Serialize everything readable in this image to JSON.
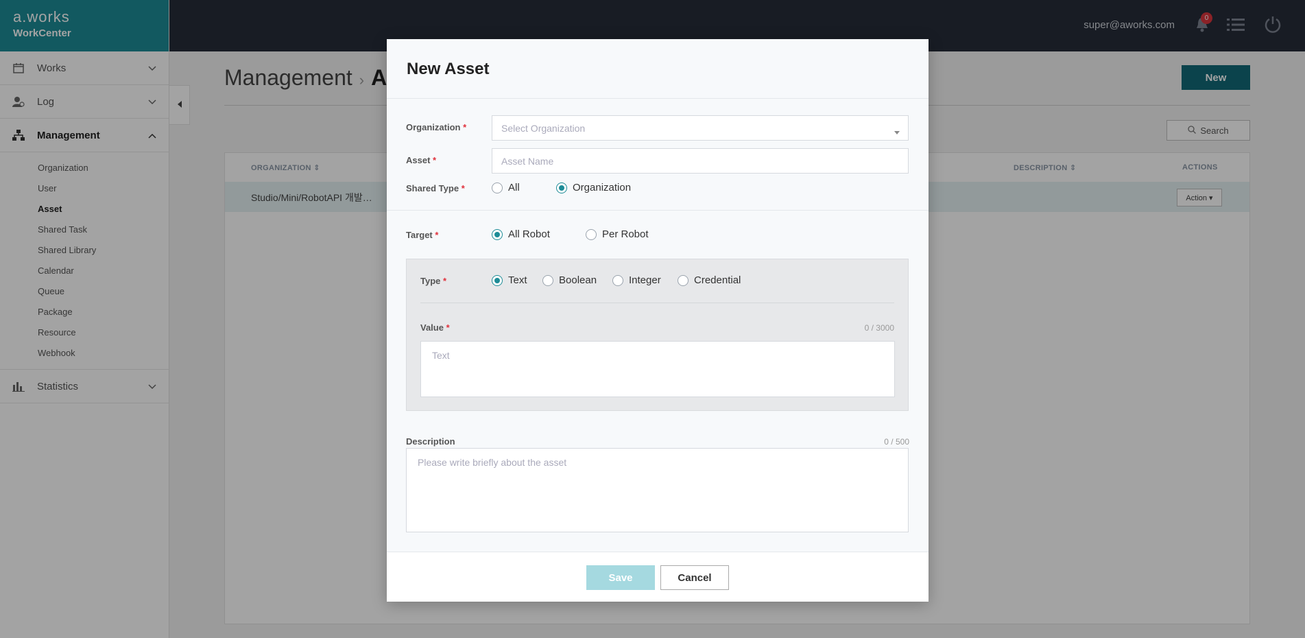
{
  "brand": {
    "logo": "a.works",
    "sub": "WorkCenter"
  },
  "sidebar": {
    "menus": [
      {
        "label": "Works",
        "icon": "calendar-icon"
      },
      {
        "label": "Log",
        "icon": "user-log-icon"
      },
      {
        "label": "Management",
        "icon": "org-tree-icon"
      },
      {
        "label": "Statistics",
        "icon": "bar-chart-icon"
      }
    ],
    "submenu": [
      "Organization",
      "User",
      "Asset",
      "Shared Task",
      "Shared Library",
      "Calendar",
      "Queue",
      "Package",
      "Resource",
      "Webhook"
    ]
  },
  "topbar": {
    "user": "super@aworks.com",
    "notifications": "0"
  },
  "page": {
    "breadcrumb_root": "Management",
    "breadcrumb_current": "A",
    "new_label": "New",
    "search_label": "Search"
  },
  "table": {
    "headers": {
      "organization": "ORGANIZATION",
      "description": "DESCRIPTION",
      "actions": "ACTIONS"
    },
    "row": {
      "organization": "Studio/Mini/RobotAPI 개발…",
      "action": "Action"
    }
  },
  "modal": {
    "title": "New Asset",
    "organization_label": "Organization",
    "organization_placeholder": "Select Organization",
    "asset_label": "Asset",
    "asset_placeholder": "Asset Name",
    "shared_type_label": "Shared Type",
    "shared_type_options": [
      "All",
      "Organization"
    ],
    "target_label": "Target",
    "target_options": [
      "All Robot",
      "Per Robot"
    ],
    "type_label": "Type",
    "type_options": [
      "Text",
      "Boolean",
      "Integer",
      "Credential"
    ],
    "value_label": "Value",
    "value_counter": "0 / 3000",
    "value_placeholder": "Text",
    "description_label": "Description",
    "description_counter": "0 / 500",
    "description_placeholder": "Please write briefly about the asset",
    "save_label": "Save",
    "cancel_label": "Cancel",
    "required_mark": "*"
  },
  "colors": {
    "accent": "#1d8c97",
    "topbar": "#262c39",
    "primary_button": "#126a78",
    "required": "#e0313c"
  }
}
